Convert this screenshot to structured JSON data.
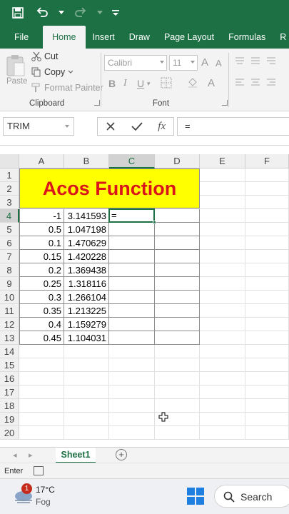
{
  "quick_access": {
    "save_icon": "save-icon",
    "undo_icon": "undo-icon",
    "redo_icon": "redo-icon",
    "customize_icon": "chevron-down-icon"
  },
  "ribbon_tabs": [
    "File",
    "Home",
    "Insert",
    "Draw",
    "Page Layout",
    "Formulas",
    "R"
  ],
  "clipboard": {
    "paste": "Paste",
    "cut": "Cut",
    "copy": "Copy",
    "format_painter": "Format Painter",
    "group_label": "Clipboard"
  },
  "font": {
    "name": "Calibri",
    "size": "11",
    "grow": "A",
    "shrink": "A",
    "bold": "B",
    "italic": "I",
    "underline": "U",
    "group_label": "Font"
  },
  "formula_bar": {
    "name_box": "TRIM",
    "fx": "fx",
    "value": "="
  },
  "columns": [
    "A",
    "B",
    "C",
    "D",
    "E",
    "F"
  ],
  "rows": [
    "1",
    "2",
    "3",
    "4",
    "5",
    "6",
    "7",
    "8",
    "9",
    "10",
    "11",
    "12",
    "13",
    "14",
    "15",
    "16",
    "17",
    "18",
    "19",
    "20"
  ],
  "sheet_title": "Acos Function",
  "table": [
    {
      "a": "-1",
      "b": "3.141593"
    },
    {
      "a": "0.5",
      "b": "1.047198"
    },
    {
      "a": "0.1",
      "b": "1.470629"
    },
    {
      "a": "0.15",
      "b": "1.420228"
    },
    {
      "a": "0.2",
      "b": "1.369438"
    },
    {
      "a": "0.25",
      "b": "1.318116"
    },
    {
      "a": "0.3",
      "b": "1.266104"
    },
    {
      "a": "0.35",
      "b": "1.213225"
    },
    {
      "a": "0.4",
      "b": "1.159279"
    },
    {
      "a": "0.45",
      "b": "1.104031"
    }
  ],
  "active_cell": {
    "ref": "C4",
    "content": "="
  },
  "sheet_tabs": [
    "Sheet1"
  ],
  "status": {
    "mode": "Enter"
  },
  "taskbar": {
    "badge": "1",
    "temperature": "17°C",
    "condition": "Fog",
    "search": "Search"
  },
  "colors": {
    "excel_green": "#1d7044",
    "title_fill": "#ffff00",
    "title_text": "#d9141b"
  }
}
